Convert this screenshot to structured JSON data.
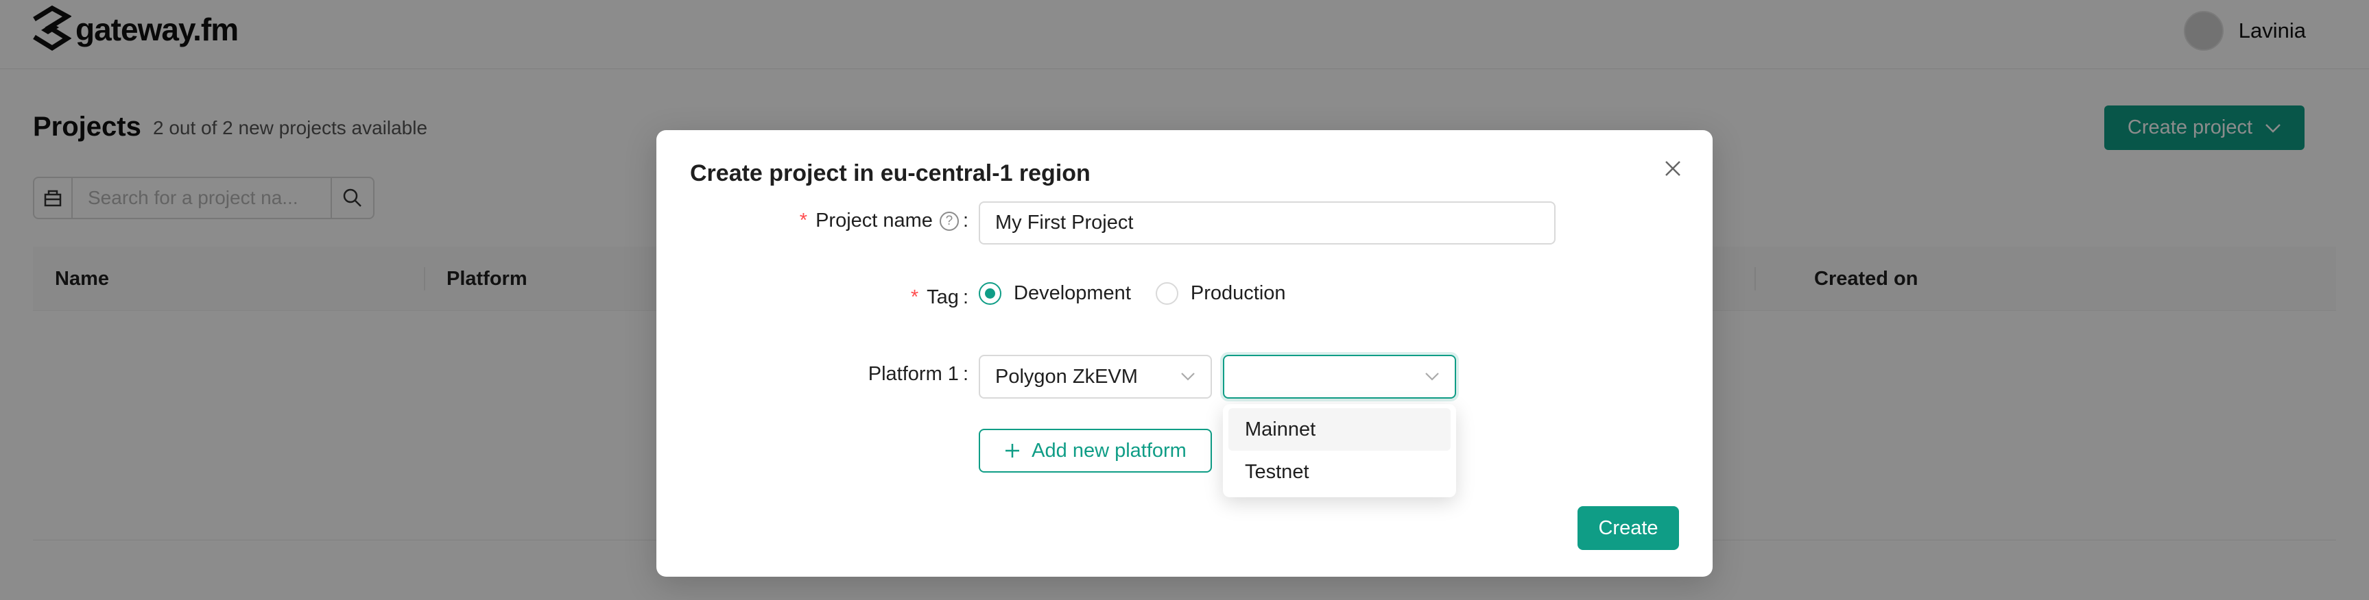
{
  "app": {
    "logo_text": "gateway.fm"
  },
  "user": {
    "name": "Lavinia"
  },
  "projects": {
    "title": "Projects",
    "subtitle": "2 out of 2 new projects available",
    "create_button": "Create project"
  },
  "search": {
    "placeholder": "Search for a project na..."
  },
  "table": {
    "columns": [
      "Name",
      "Platform",
      "Created on"
    ]
  },
  "modal": {
    "title": "Create project in eu-central-1 region",
    "project_name_label": "Project name",
    "project_name_value": "My First Project",
    "tag_label": "Tag",
    "tag_options": [
      "Development",
      "Production"
    ],
    "tag_selected": "Development",
    "platform_label": "Platform 1",
    "platform_value": "Polygon ZkEVM",
    "network_value": "",
    "network_options": [
      "Mainnet",
      "Testnet"
    ],
    "add_platform_label": "Add new platform",
    "create_label": "Create"
  },
  "colors": {
    "accent": "#0f9d86",
    "required": "#ff4d4f"
  }
}
